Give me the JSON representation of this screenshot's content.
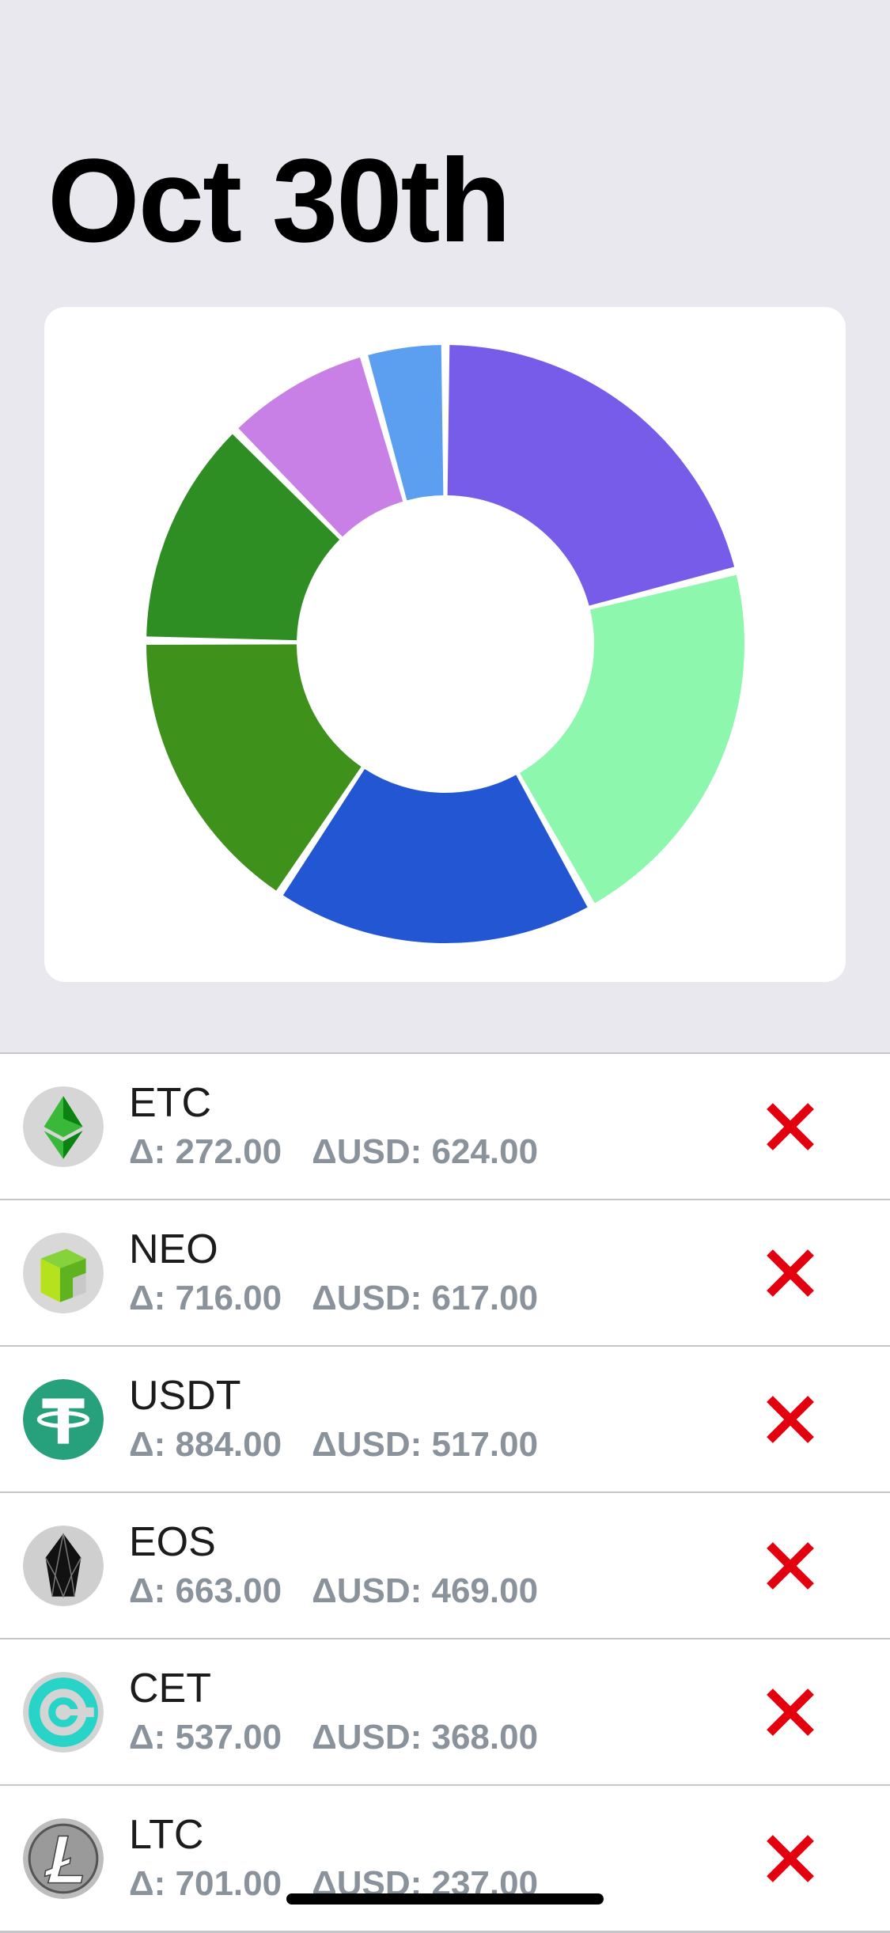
{
  "header": {
    "title": "Oct 30th"
  },
  "colors": {
    "background": "#e9e8ef",
    "delete": "#e3000f",
    "detail_text": "#8a939c"
  },
  "chart_data": {
    "type": "pie",
    "style": "donut",
    "title": "",
    "slices": [
      {
        "label": "ETC",
        "value": 624.0,
        "color": "#775cea"
      },
      {
        "label": "NEO",
        "value": 617.0,
        "color": "#8ef7ae"
      },
      {
        "label": "USDT",
        "value": 517.0,
        "color": "#2256d2"
      },
      {
        "label": "EOS",
        "value": 469.0,
        "color": "#3e921b"
      },
      {
        "label": "CET",
        "value": 368.0,
        "color": "#2e8e24"
      },
      {
        "label": "LTC",
        "value": 237.0,
        "color": "#c880e6"
      },
      {
        "label": "",
        "value": 130.0,
        "color": "#5c9ff0"
      }
    ]
  },
  "coins": [
    {
      "symbol": "ETC",
      "delta_text": "Δ: 272.00",
      "usd_text": "ΔUSD: 624.00",
      "icon": "etc-icon"
    },
    {
      "symbol": "NEO",
      "delta_text": "Δ: 716.00",
      "usd_text": "ΔUSD: 617.00",
      "icon": "neo-icon"
    },
    {
      "symbol": "USDT",
      "delta_text": "Δ: 884.00",
      "usd_text": "ΔUSD: 517.00",
      "icon": "usdt-icon"
    },
    {
      "symbol": "EOS",
      "delta_text": "Δ: 663.00",
      "usd_text": "ΔUSD: 469.00",
      "icon": "eos-icon"
    },
    {
      "symbol": "CET",
      "delta_text": "Δ: 537.00",
      "usd_text": "ΔUSD: 368.00",
      "icon": "cet-icon"
    },
    {
      "symbol": "LTC",
      "delta_text": "Δ: 701.00",
      "usd_text": "ΔUSD: 237.00",
      "icon": "ltc-icon"
    }
  ]
}
